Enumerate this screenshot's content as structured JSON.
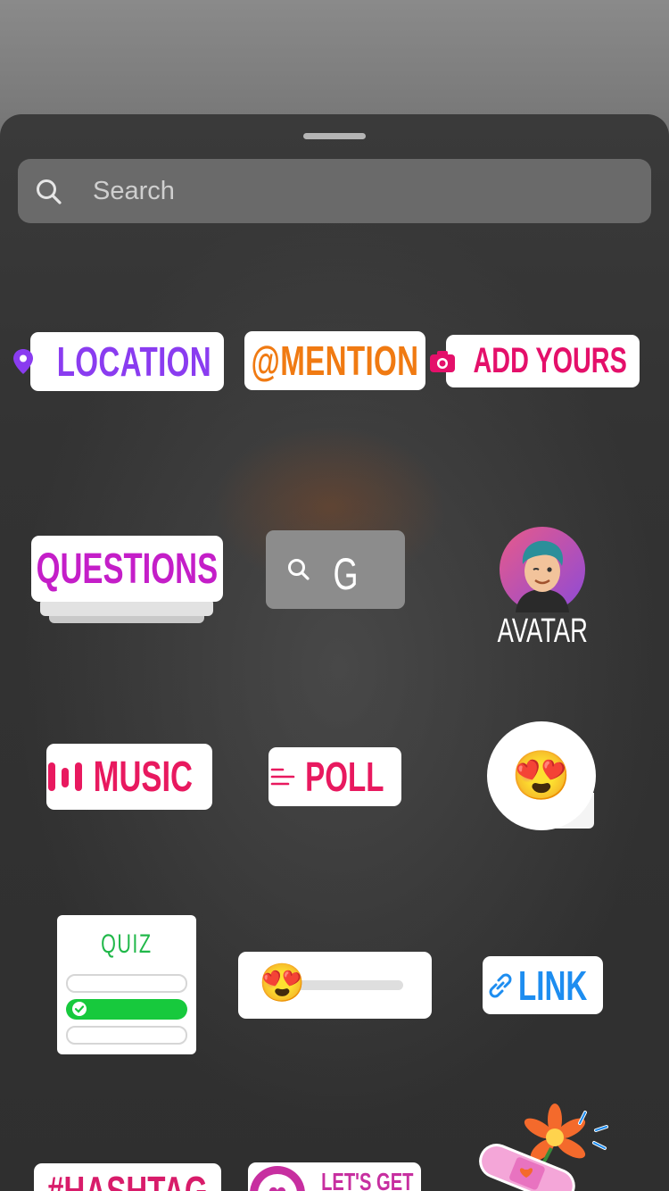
{
  "search": {
    "placeholder": "Search"
  },
  "stickers": {
    "location": "LOCATION",
    "mention": "@MENTION",
    "add_yours": "ADD YOURS",
    "questions": "QUESTIONS",
    "gif": "G",
    "avatar": "AVATAR",
    "music": "MUSIC",
    "poll": "POLL",
    "emoji_reaction": "😍",
    "quiz": "QUIZ",
    "slider_emoji": "😍",
    "link": "LINK",
    "hashtag": "#HASHTAG",
    "lets_get": "LET'S GET"
  },
  "colors": {
    "location": "#8a3cf0",
    "mention": "#f07a12",
    "add_yours": "#e4106a",
    "questions": "#c41ec8",
    "music": "#e8195f",
    "poll": "#e8195f",
    "quiz_title": "#21b84a",
    "quiz_bar": "#17c93d",
    "link": "#1d8df0",
    "hashtag": "#d81c6a"
  }
}
